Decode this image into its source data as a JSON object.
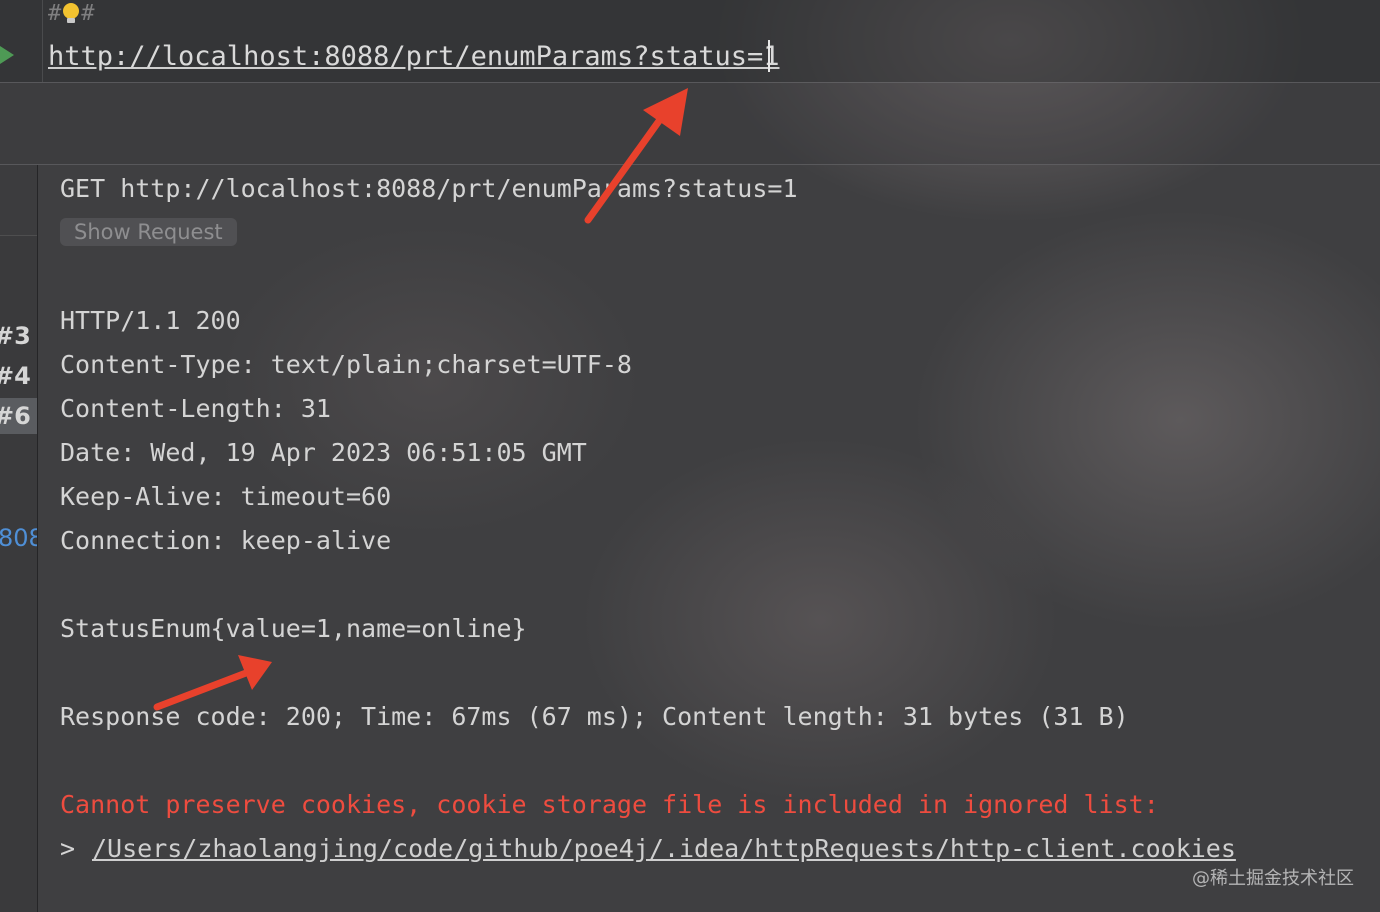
{
  "editor": {
    "comment_prefix": "#",
    "comment_suffix": "#",
    "request_url": "http://localhost:8088/prt/enumParams?status=1"
  },
  "history": {
    "items": [
      "#3",
      "#4",
      "#6"
    ],
    "selected": "#6",
    "link_fragment": "808"
  },
  "response": {
    "request_line": "GET http://localhost:8088/prt/enumParams?status=1",
    "show_request_label": "Show Request",
    "status_line": "HTTP/1.1 200",
    "headers": [
      "Content-Type: text/plain;charset=UTF-8",
      "Content-Length: 31",
      "Date: Wed, 19 Apr 2023 06:51:05 GMT",
      "Keep-Alive: timeout=60",
      "Connection: keep-alive"
    ],
    "body": "StatusEnum{value=1,name=online}",
    "summary": "Response code: 200; Time: 67ms (67 ms); Content length: 31 bytes (31 B)",
    "cookie_warning": "Cannot preserve cookies, cookie storage file is included in ignored list:",
    "cookie_path_prefix": ">",
    "cookie_path": "/Users/zhaolangjing/code/github/poe4j/.idea/httpRequests/http-client.cookies"
  },
  "colors": {
    "accent_error": "#ee4c3f",
    "annotation_arrow": "#e8412c",
    "run_icon": "#4e9a55",
    "link_blue": "#4f8fd6"
  },
  "watermark": "@稀土掘金技术社区"
}
